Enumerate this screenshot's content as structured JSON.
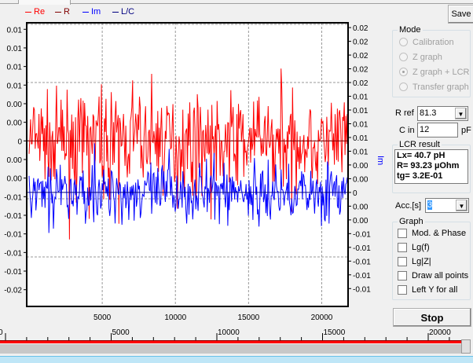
{
  "legend": [
    {
      "label": "Re",
      "color": "#ff0000"
    },
    {
      "label": "R",
      "color": "#800000"
    },
    {
      "label": "Im",
      "color": "#0000ff"
    },
    {
      "label": "L/C",
      "color": "#000080"
    }
  ],
  "save_label": "Save",
  "mode": {
    "title": "Mode",
    "options": [
      "Calibration",
      "Z graph",
      "Z graph + LCR",
      "Transfer graph"
    ],
    "selected": "Z graph + LCR"
  },
  "rref": {
    "label": "R ref",
    "value": "81.3"
  },
  "cin": {
    "label": "C in",
    "value": "12",
    "unit": "pF"
  },
  "lcr": {
    "title": "LCR result",
    "lines": [
      "Lx= 40.7 pH",
      "R= 93.23 µOhm",
      "tg= 3.2E-01"
    ]
  },
  "acc": {
    "label": "Acc.[s]",
    "value": "3"
  },
  "graph": {
    "title": "Graph",
    "options": [
      "Mod. & Phase",
      "Lg(f)",
      "Lg|Z|",
      "Draw all points",
      "Left Y for all"
    ]
  },
  "stop_label": "Stop",
  "right_axis_label": "Im",
  "ruler_labels": [
    "0",
    "5000",
    "10000",
    "15000",
    "20000"
  ],
  "chart_data": {
    "type": "line",
    "x_ticks": [
      "5000",
      "10000",
      "15000",
      "20000"
    ],
    "x_range": [
      0,
      21800
    ],
    "left_ticks": [
      "0.01",
      "0.01",
      "0.01",
      "0.01",
      "0.00",
      "0.00",
      "0",
      "0.00",
      "0.00",
      "-0.01",
      "-0.01",
      "-0.01",
      "-0.01",
      "-0.01",
      "-0.02"
    ],
    "left_range": [
      -0.0178,
      0.0127
    ],
    "right_ticks": [
      "0.02",
      "0.02",
      "0.02",
      "0.02",
      "0.02",
      "0.01",
      "0.01",
      "0.01",
      "0.01",
      "0.01",
      "0.00",
      "0.00",
      "0",
      "0.00",
      "0.00",
      "-0.01",
      "-0.01",
      "-0.01",
      "-0.01",
      "-0.01"
    ],
    "right_range": [
      -0.0166,
      0.0247
    ],
    "series": [
      {
        "name": "Re",
        "color": "#ff0000",
        "axis": "left",
        "mean": 0.0,
        "noise": 0.004
      },
      {
        "name": "R",
        "color": "#800000",
        "axis": "left",
        "constant": 0.0
      },
      {
        "name": "Im",
        "color": "#0000ff",
        "axis": "right",
        "mean": 0.0,
        "noise": 0.0035
      },
      {
        "name": "L/C",
        "color": "#000080",
        "axis": "right",
        "constant": 0.0
      }
    ],
    "grid": true
  }
}
